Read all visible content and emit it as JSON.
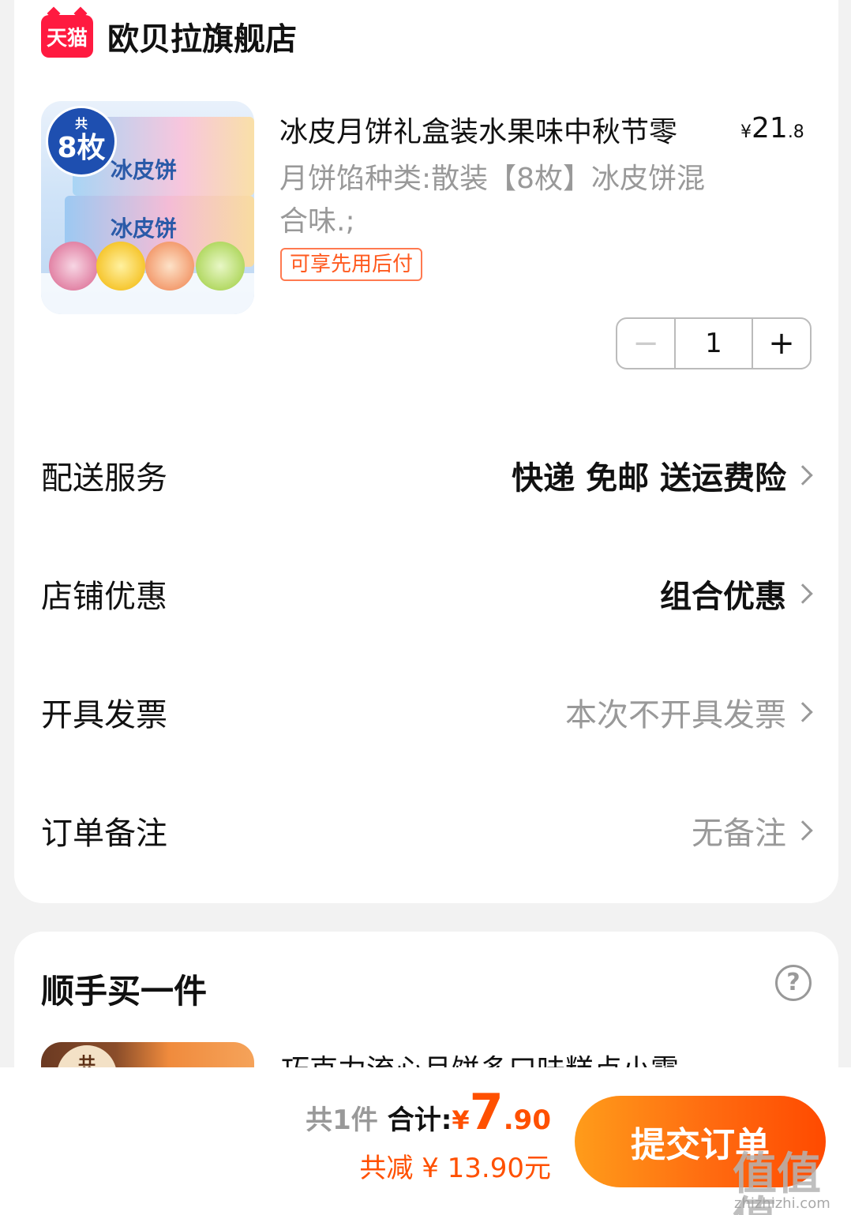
{
  "shop": {
    "logo_text": "天猫",
    "name": "欧贝拉旗舰店"
  },
  "product": {
    "title": "冰皮月饼礼盒装水果味中秋节零",
    "price_symbol": "¥",
    "price_int": "21",
    "price_dec": ".8",
    "sku": "月饼馅种类:散装【8枚】冰皮饼混合味.;",
    "tag": "可享先用后付",
    "image_badge_top": "共",
    "image_badge_main": "8枚",
    "image_box_label": "冰皮饼",
    "image_box_label2": "冰皮饼",
    "quantity": "1",
    "minus_symbol": "−",
    "plus_symbol": "+"
  },
  "rows": {
    "delivery": {
      "label": "配送服务",
      "value": "快递 免邮 送运费险"
    },
    "discount": {
      "label": "店铺优惠",
      "value": "组合优惠"
    },
    "invoice": {
      "label": "开具发票",
      "value": "本次不开具发票"
    },
    "note": {
      "label": "订单备注",
      "value": "无备注"
    }
  },
  "addon": {
    "title": "顺手买一件",
    "help_symbol": "?",
    "item_badge": "共",
    "item_title": "巧克力流心月饼多口味糕点小零"
  },
  "footer": {
    "count": "共1件",
    "total_label": "合计:",
    "yen": "¥",
    "total_int": "7",
    "total_dec": ".90",
    "saved": "共减 ¥ 13.90元",
    "submit": "提交订单"
  },
  "watermark": {
    "main": "值值值",
    "url": "zhizhizhi.com"
  },
  "colors": {
    "accent": "#ff5000",
    "tmall": "#ff1a40",
    "button_start": "#ff9c1a",
    "button_end": "#ff4a00"
  },
  "icons": [
    "tmall-logo",
    "chevron-right-icon",
    "help-circle-icon",
    "minus-icon",
    "plus-icon"
  ]
}
